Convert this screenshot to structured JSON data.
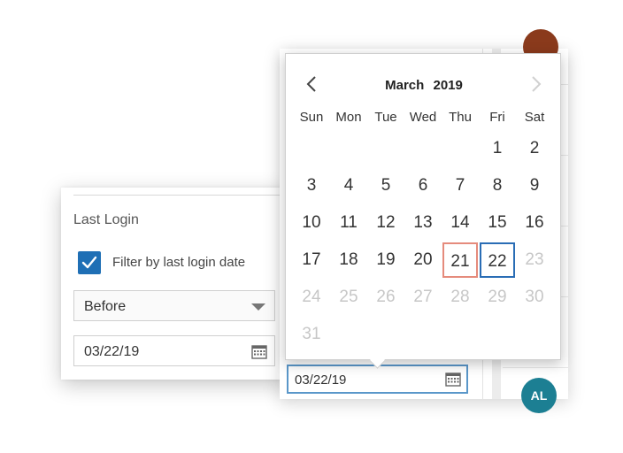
{
  "filter_panel": {
    "heading": "Last Login",
    "checkbox_label": "Filter by last login date",
    "checkbox_checked": true,
    "condition_select": "Before",
    "date_value": "03/22/19"
  },
  "calendar": {
    "month": "March",
    "year": "2019",
    "weekdays": [
      "Sun",
      "Mon",
      "Tue",
      "Wed",
      "Thu",
      "Fri",
      "Sat"
    ],
    "weeks": [
      [
        "",
        "",
        "",
        "",
        "",
        "1",
        "2"
      ],
      [
        "3",
        "4",
        "5",
        "6",
        "7",
        "8",
        "9"
      ],
      [
        "10",
        "11",
        "12",
        "13",
        "14",
        "15",
        "16"
      ],
      [
        "17",
        "18",
        "19",
        "20",
        "21",
        "22",
        "23"
      ],
      [
        "24",
        "25",
        "26",
        "27",
        "28",
        "29",
        "30"
      ],
      [
        "31",
        "",
        "",
        "",
        "",
        "",
        ""
      ]
    ],
    "today": "21",
    "selected": "22",
    "disabled_after": "22",
    "date_input_value": "03/22/19"
  },
  "background_page": {
    "avatar_initials": "AL"
  },
  "colors": {
    "primary": "#1f6fb5",
    "today_border": "#e58b7c",
    "selected_border": "#2a6db5",
    "disabled_text": "#c7c7c7"
  }
}
